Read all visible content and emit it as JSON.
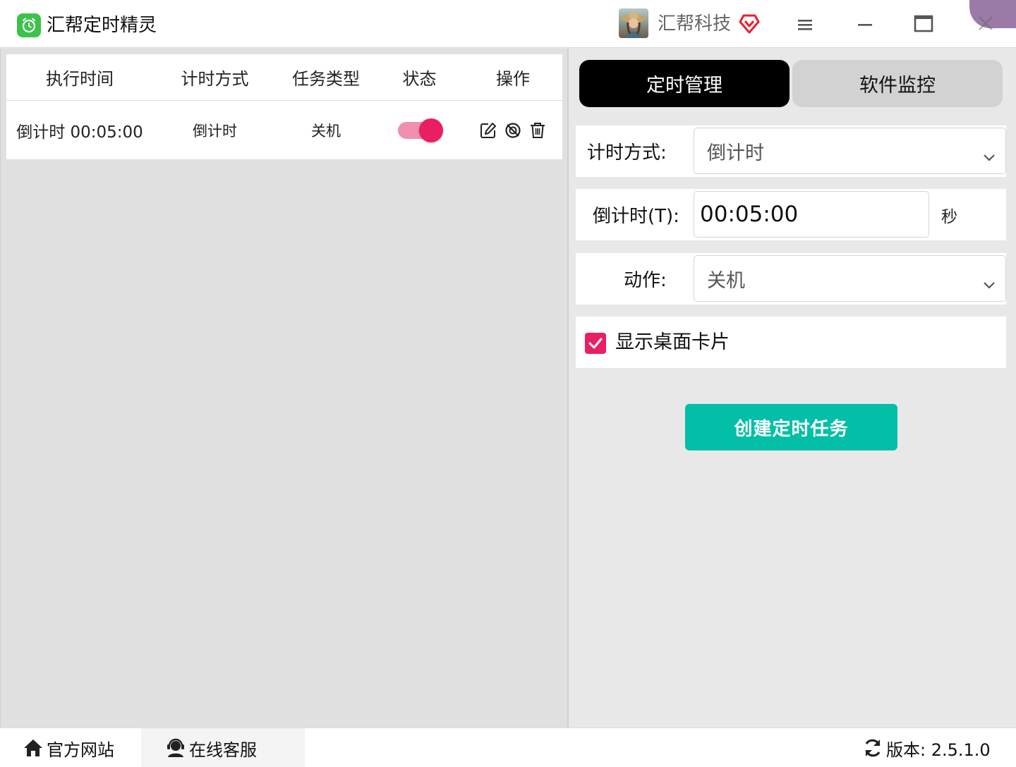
{
  "app": {
    "title": "汇帮定时精灵",
    "user_name": "汇帮科技"
  },
  "colors": {
    "accent": "#e91e63",
    "primary_button": "#03bfa7",
    "logo_green": "#3cc24b",
    "tab_active_bg": "#000000",
    "tab_inactive_bg": "#d2d2d2"
  },
  "table": {
    "headers": [
      "执行时间",
      "计时方式",
      "任务类型",
      "状态",
      "操作"
    ],
    "rows": [
      {
        "exec_time": "倒计时 00:05:00",
        "timing_mode": "倒计时",
        "task_type": "关机",
        "enabled": true
      }
    ]
  },
  "tabs": [
    {
      "label": "定时管理",
      "active": true
    },
    {
      "label": "软件监控",
      "active": false
    }
  ],
  "form": {
    "timing_label": "计时方式:",
    "timing_value": "倒计时",
    "countdown_label": "倒计时(T):",
    "countdown_value": "00:05:00",
    "countdown_unit": "秒",
    "action_label": "动作:",
    "action_value": "关机",
    "show_card_label": "显示桌面卡片",
    "show_card_checked": true,
    "create_button": "创建定时任务"
  },
  "footer": {
    "site_label": "官方网站",
    "service_label": "在线客服",
    "version_label": "版本: 2.5.1.0"
  },
  "icons": [
    "alarm-clock-icon",
    "vip-heart-icon",
    "menu-icon",
    "minimize-icon",
    "maximize-icon",
    "close-icon",
    "edit-icon",
    "disable-icon",
    "delete-icon",
    "chevron-down-icon",
    "checkmark-icon",
    "home-icon",
    "customer-service-icon",
    "refresh-icon"
  ]
}
